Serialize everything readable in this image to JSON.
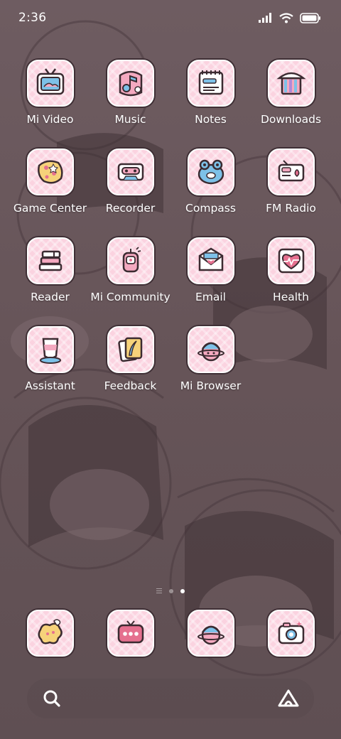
{
  "status_bar": {
    "time": "2:36",
    "icons": [
      "signal-icon",
      "wifi-icon",
      "battery-icon"
    ]
  },
  "apps": [
    {
      "label": "Mi Video",
      "icon": "tv-icon"
    },
    {
      "label": "Music",
      "icon": "music-note-icon"
    },
    {
      "label": "Notes",
      "icon": "notepad-icon"
    },
    {
      "label": "Downloads",
      "icon": "download-box-icon"
    },
    {
      "label": "Game Center",
      "icon": "cookie-icon"
    },
    {
      "label": "Recorder",
      "icon": "cassette-icon"
    },
    {
      "label": "Compass",
      "icon": "frog-icon"
    },
    {
      "label": "FM Radio",
      "icon": "radio-icon"
    },
    {
      "label": "Reader",
      "icon": "books-icon"
    },
    {
      "label": "Mi Community",
      "icon": "lantern-icon"
    },
    {
      "label": "Email",
      "icon": "envelope-icon"
    },
    {
      "label": "Health",
      "icon": "heart-icon"
    },
    {
      "label": "Assistant",
      "icon": "cup-icon"
    },
    {
      "label": "Feedback",
      "icon": "feather-note-icon"
    },
    {
      "label": "Mi Browser",
      "icon": "planet-icon"
    }
  ],
  "page_indicator": {
    "pages": 2,
    "active": 2
  },
  "dock": [
    {
      "icon": "speech-bubble-icon"
    },
    {
      "icon": "chat-bubble-icon"
    },
    {
      "icon": "planet-icon"
    },
    {
      "icon": "camera-icon"
    }
  ],
  "search_bar": {
    "left_icon": "search-icon",
    "right_icon": "assistant-logo-icon"
  },
  "colors": {
    "icon_bg": "#fbd3e0",
    "icon_inner": "#fff1f5",
    "outline": "#3b2b31",
    "wallpaper": "#6b5a5e"
  }
}
